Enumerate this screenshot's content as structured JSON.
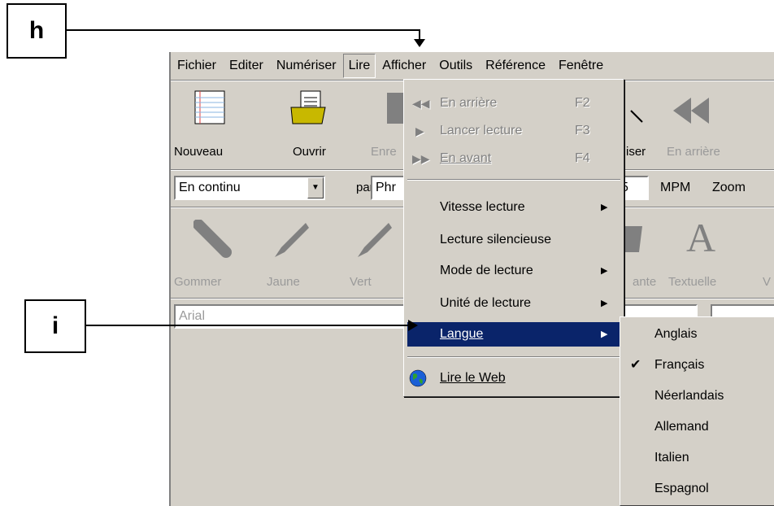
{
  "callouts": {
    "h": "h",
    "i": "i"
  },
  "menubar": [
    "Fichier",
    "Editer",
    "Numériser",
    "Lire",
    "Afficher",
    "Outils",
    "Référence",
    "Fenêtre"
  ],
  "toolbar1": {
    "nouveau": "Nouveau",
    "ouvrir": "Ouvrir",
    "enregistrer": "Enre",
    "numeriser": "iser",
    "en_arriere": "En arrière"
  },
  "toolbar2": {
    "mode_value": "En continu",
    "par": "par",
    "unit_value": "Phr",
    "speed_value": "5",
    "mpm": "MPM",
    "zoom": "Zoom"
  },
  "toolbar3": {
    "gommer": "Gommer",
    "jaune": "Jaune",
    "vert": "Vert",
    "surlignante": "ante",
    "textuelle": "Textuelle",
    "more": "V"
  },
  "font_combo": {
    "value": "Arial"
  },
  "lire_menu": {
    "en_arriere": {
      "label": "En arrière",
      "shortcut": "F2"
    },
    "lancer": {
      "label": "Lancer lecture",
      "shortcut": "F3"
    },
    "en_avant": {
      "label": "En avant",
      "shortcut": "F4"
    },
    "vitesse": "Vitesse lecture",
    "silencieuse": "Lecture silencieuse",
    "mode": "Mode de lecture",
    "unite": "Unité de lecture",
    "langue": "Langue",
    "web": "Lire le Web"
  },
  "langue_menu": [
    "Anglais",
    "Français",
    "Néerlandais",
    "Allemand",
    "Italien",
    "Espagnol"
  ],
  "checked_language": "Français",
  "colors": {
    "highlight": "#0a246a",
    "face": "#d4d0c8"
  }
}
